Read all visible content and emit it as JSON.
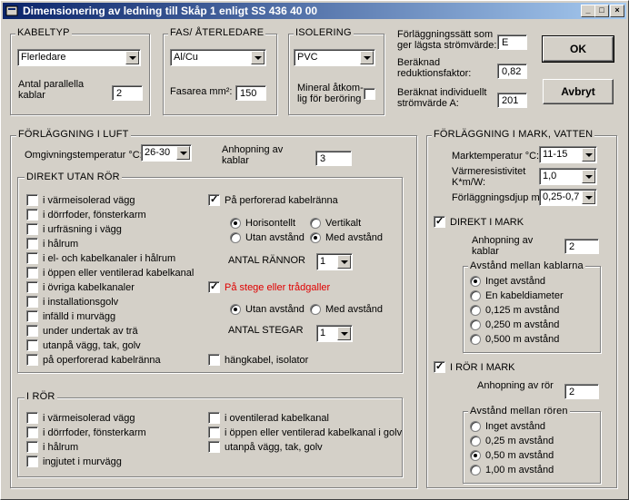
{
  "window": {
    "title": "Dimensionering av ledning till Skåp 1 enligt SS 436 40 00",
    "min": "_",
    "max": "□",
    "close": "×"
  },
  "kabeltyp": {
    "title": "KABELTYP",
    "value": "Flerledare",
    "parallel_label_1": "Antal parallella",
    "parallel_label_2": "kablar",
    "parallel_value": "2"
  },
  "fas": {
    "title": "FAS/ ÅTERLEDARE",
    "value": "Al/Cu",
    "area_label": "Fasarea mm²:",
    "area_value": "150"
  },
  "isolering": {
    "title": "ISOLERING",
    "value": "PVC",
    "mineral_label_1": "Mineral åtkom-",
    "mineral_label_2": "lig för beröring",
    "mineral_checked": false
  },
  "results": {
    "sett_label_1": "Förläggningssätt som",
    "sett_label_2": "ger lägsta strömvärde:",
    "sett_value": "E",
    "red_label_1": "Beräknad",
    "red_label_2": "reduktionsfaktor:",
    "red_value": "0,82",
    "cur_label_1": "Beräknat individuellt",
    "cur_label_2": "strömvärde A:",
    "cur_value": "201"
  },
  "buttons": {
    "ok": "OK",
    "cancel": "Avbryt"
  },
  "luft": {
    "title": "FÖRLÄGGNING I LUFT",
    "temp_label": "Omgivningstemperatur °C:",
    "temp_value": "26-30",
    "anhop_label_1": "Anhopning av",
    "anhop_label_2": "kablar",
    "anhop_value": "3",
    "direkt": {
      "title": "DIREKT UTAN RÖR",
      "items": [
        "i värmeisolerad vägg",
        "i dörrfoder, fönsterkarm",
        "i urfräsning i vägg",
        "i hålrum",
        "i el- och kabelkanaler i hålrum",
        "i öppen eller ventilerad kabelkanal",
        "i övriga kabelkanaler",
        "i installationsgolv",
        "infälld i murvägg",
        "under undertak av trä",
        "utanpå vägg, tak, golv",
        "på operforerad kabelränna"
      ],
      "perforerad": "På perforerad kabelränna",
      "horisontellt": "Horisontellt",
      "vertikalt": "Vertikalt",
      "utan_avstand": "Utan avstånd",
      "med_avstand": "Med avstånd",
      "rannor_label": "ANTAL RÄNNOR",
      "rannor_value": "1",
      "stege": "På stege eller trådgaller",
      "stege_utan": "Utan avstånd",
      "stege_med": "Med avstånd",
      "stegar_label": "ANTAL STEGAR",
      "stegar_value": "1",
      "hangkabel": "hängkabel, isolator"
    },
    "ror": {
      "title": "I RÖR",
      "left": [
        "i värmeisolerad vägg",
        "i dörrfoder, fönsterkarm",
        "i hålrum",
        "ingjutet i murvägg"
      ],
      "right": [
        "i oventilerad kabelkanal",
        "i öppen eller ventilerad kabelkanal i golv",
        "utanpå vägg, tak, golv"
      ]
    }
  },
  "mark": {
    "title": "FÖRLÄGGNING I MARK, VATTEN",
    "temp_label": "Marktemperatur °C:",
    "temp_value": "11-15",
    "resist_label_1": "Värmeresistivitet",
    "resist_label_2": "K*m/W:",
    "resist_value": "1,0",
    "djup_label": "Förläggningsdjup m:",
    "djup_value": "0,25-0,7",
    "direkt_label": "DIREKT I MARK",
    "anhop_label_1": "Anhopning av",
    "anhop_label_2": "kablar",
    "anhop_value": "2",
    "kabl_title": "Avstånd mellan kablarna",
    "kabl_options": [
      "Inget avstånd",
      "En kabeldiameter",
      "0,125 m avstånd",
      "0,250 m avstånd",
      "0,500 m avstånd"
    ],
    "ror_label": "I RÖR I MARK",
    "ror_anhop_label": "Anhopning av rör",
    "ror_anhop_value": "2",
    "ror_title": "Avstånd mellan rören",
    "ror_options": [
      "Inget avstånd",
      "0,25 m avstånd",
      "0,50 m avstånd",
      "1,00 m avstånd"
    ]
  }
}
